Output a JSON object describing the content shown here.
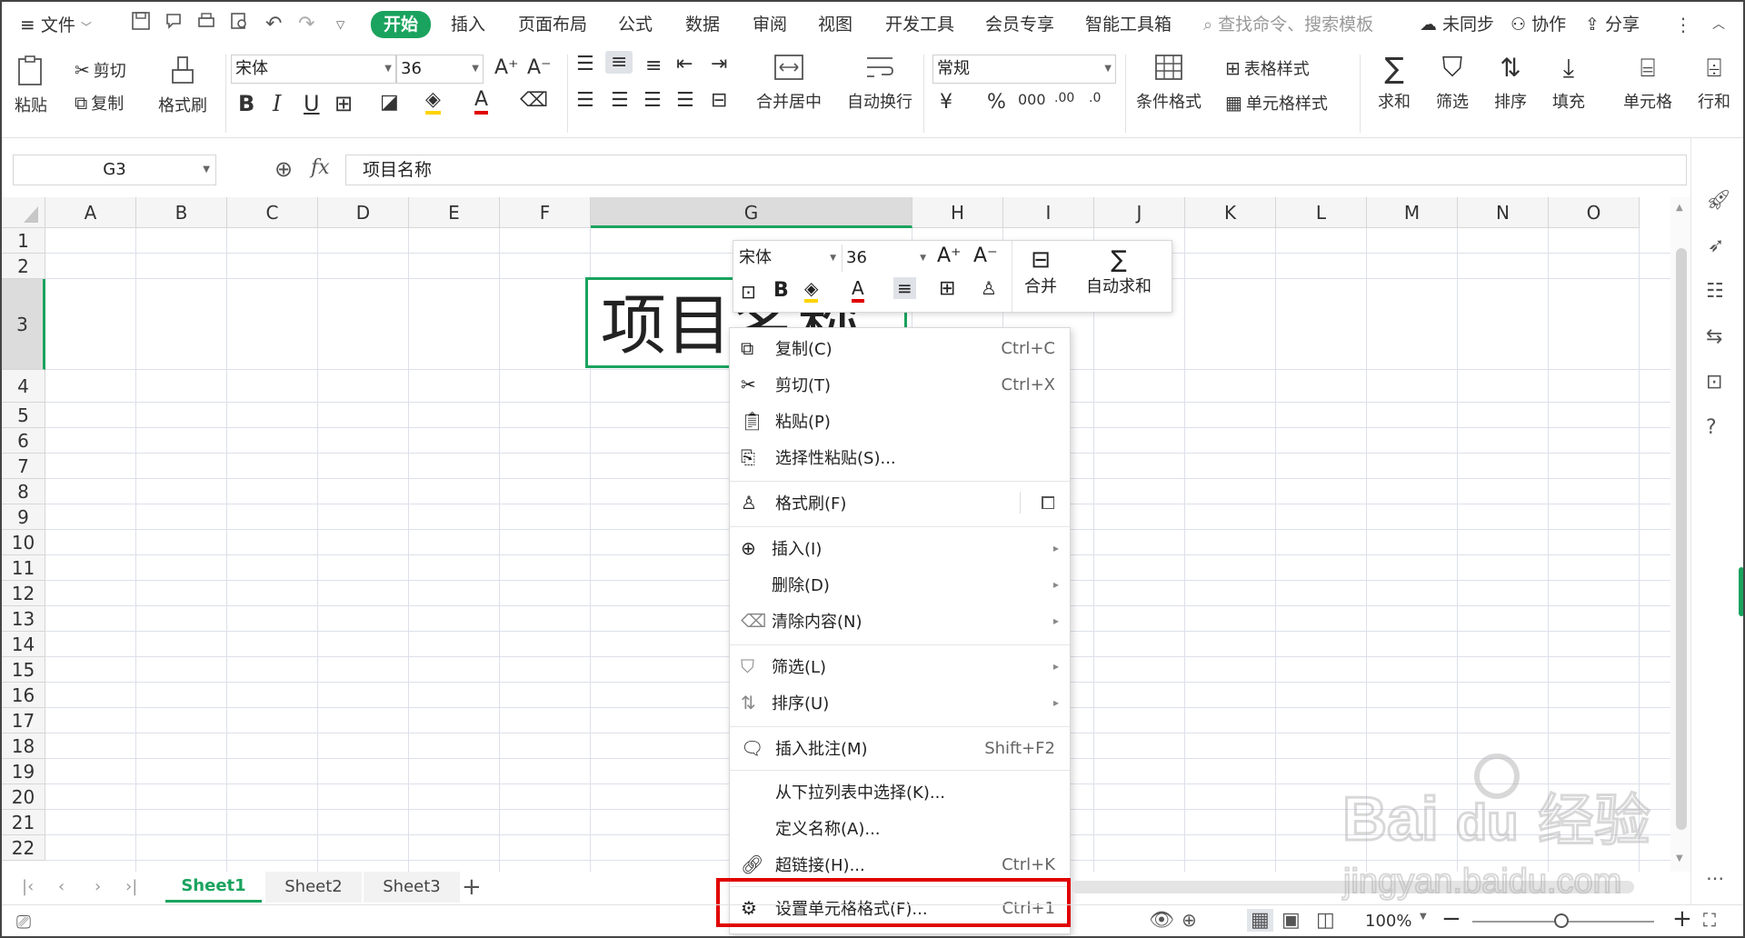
{
  "tabbar": {
    "file_label": "文件",
    "tabs": [
      "开始",
      "插入",
      "页面布局",
      "公式",
      "数据",
      "审阅",
      "视图",
      "开发工具",
      "会员专享",
      "智能工具箱"
    ],
    "search_placeholder": "查找命令、搜索模板",
    "sync_label": "未同步",
    "collab_label": "协作",
    "share_label": "分享"
  },
  "ribbon": {
    "paste": "粘贴",
    "cut": "剪切",
    "copy": "复制",
    "format_painter": "格式刷",
    "font_name": "宋体",
    "font_size": "36",
    "merge_center": "合并居中",
    "wrap_text": "自动换行",
    "number_format": "常规",
    "conditional_format": "条件格式",
    "table_style": "表格样式",
    "cell_style": "单元格样式",
    "sum": "求和",
    "filter": "筛选",
    "sort": "排序",
    "fill": "填充",
    "cell": "单元格",
    "row_col": "行和"
  },
  "formula_bar": {
    "name_box": "G3",
    "fx": "fx",
    "value": "项目名称"
  },
  "grid": {
    "columns": [
      "A",
      "B",
      "C",
      "D",
      "E",
      "F",
      "G",
      "H",
      "I",
      "J",
      "K",
      "L",
      "M",
      "N",
      "O"
    ],
    "rows": [
      "1",
      "2",
      "3",
      "4",
      "5",
      "6",
      "7",
      "8",
      "9",
      "10",
      "11",
      "12",
      "13",
      "14",
      "15",
      "16",
      "17",
      "18",
      "19",
      "20",
      "21",
      "22"
    ],
    "selected_cell_text": "项目名称"
  },
  "mini_toolbar": {
    "font_name": "宋体",
    "font_size": "36",
    "merge": "合并",
    "autosum": "自动求和"
  },
  "context_menu": {
    "items": [
      {
        "label": "复制(C)",
        "shortcut": "Ctrl+C"
      },
      {
        "label": "剪切(T)",
        "shortcut": "Ctrl+X"
      },
      {
        "label": "粘贴(P)",
        "shortcut": ""
      },
      {
        "label": "选择性粘贴(S)...",
        "shortcut": ""
      },
      {
        "label": "格式刷(F)",
        "shortcut": ""
      },
      {
        "label": "插入(I)",
        "shortcut": ""
      },
      {
        "label": "删除(D)",
        "shortcut": ""
      },
      {
        "label": "清除内容(N)",
        "shortcut": ""
      },
      {
        "label": "筛选(L)",
        "shortcut": ""
      },
      {
        "label": "排序(U)",
        "shortcut": ""
      },
      {
        "label": "插入批注(M)",
        "shortcut": "Shift+F2"
      },
      {
        "label": "从下拉列表中选择(K)...",
        "shortcut": ""
      },
      {
        "label": "定义名称(A)...",
        "shortcut": ""
      },
      {
        "label": "超链接(H)...",
        "shortcut": "Ctrl+K"
      },
      {
        "label": "设置单元格格式(F)...",
        "shortcut": "Ctrl+1"
      }
    ]
  },
  "sheets": [
    "Sheet1",
    "Sheet2",
    "Sheet3"
  ],
  "status": {
    "zoom": "100%"
  },
  "watermark": "Baidu经验 jingyan.baidu.com",
  "colors": {
    "accent": "#1aa35e",
    "highlight": "#e00000"
  }
}
